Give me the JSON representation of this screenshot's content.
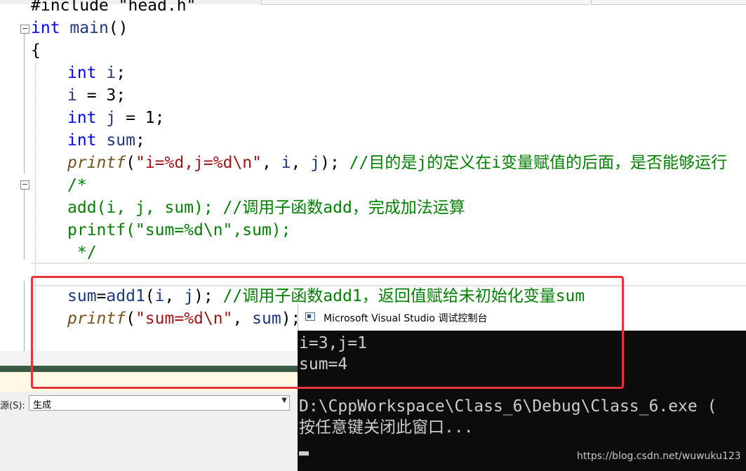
{
  "editor": {
    "lines": [
      {
        "parts": [
          {
            "c": "plain",
            "t": "#include \"head.h\""
          }
        ]
      },
      {
        "parts": [
          {
            "c": "kw",
            "t": "int"
          },
          {
            "c": "plain",
            "t": " "
          },
          {
            "c": "id",
            "t": "main"
          },
          {
            "c": "plain",
            "t": "()"
          }
        ]
      },
      {
        "parts": [
          {
            "c": "plain",
            "t": "{"
          }
        ]
      },
      {
        "parts": [
          {
            "c": "kw",
            "t": "int"
          },
          {
            "c": "plain",
            "t": " "
          },
          {
            "c": "id",
            "t": "i"
          },
          {
            "c": "plain",
            "t": ";"
          }
        ]
      },
      {
        "parts": [
          {
            "c": "id",
            "t": "i"
          },
          {
            "c": "plain",
            "t": " = 3;"
          }
        ]
      },
      {
        "parts": [
          {
            "c": "kw",
            "t": "int"
          },
          {
            "c": "plain",
            "t": " "
          },
          {
            "c": "id",
            "t": "j"
          },
          {
            "c": "plain",
            "t": " = 1;"
          }
        ]
      },
      {
        "parts": [
          {
            "c": "kw",
            "t": "int"
          },
          {
            "c": "plain",
            "t": " "
          },
          {
            "c": "id",
            "t": "sum"
          },
          {
            "c": "plain",
            "t": ";"
          }
        ]
      },
      {
        "parts": [
          {
            "c": "fn",
            "t": "printf"
          },
          {
            "c": "plain",
            "t": "("
          },
          {
            "c": "str",
            "t": "\"i=%d,j=%d"
          },
          {
            "c": "esc",
            "t": "\\n"
          },
          {
            "c": "str",
            "t": "\""
          },
          {
            "c": "plain",
            "t": ", "
          },
          {
            "c": "id",
            "t": "i"
          },
          {
            "c": "plain",
            "t": ", "
          },
          {
            "c": "id",
            "t": "j"
          },
          {
            "c": "plain",
            "t": "); "
          },
          {
            "c": "cmt",
            "t": "//目的是j的定义在i变量赋值的后面，是否能够运行"
          }
        ]
      },
      {
        "parts": [
          {
            "c": "cmt",
            "t": "/*"
          }
        ]
      },
      {
        "parts": [
          {
            "c": "cmt",
            "t": "add(i, j, sum); //调用子函数add，完成加法运算"
          }
        ]
      },
      {
        "parts": [
          {
            "c": "cmt",
            "t": "printf(\"sum=%d\\n\",sum);"
          }
        ]
      },
      {
        "parts": [
          {
            "c": "cmt",
            "t": " */"
          }
        ]
      },
      {
        "parts": [
          {
            "c": "plain",
            "t": ""
          }
        ]
      },
      {
        "parts": [
          {
            "c": "id",
            "t": "sum"
          },
          {
            "c": "plain",
            "t": "="
          },
          {
            "c": "id",
            "t": "add1"
          },
          {
            "c": "plain",
            "t": "("
          },
          {
            "c": "id",
            "t": "i"
          },
          {
            "c": "plain",
            "t": ", "
          },
          {
            "c": "id",
            "t": "j"
          },
          {
            "c": "plain",
            "t": "); "
          },
          {
            "c": "cmt",
            "t": "//调用子函数add1，返回值赋给未初始化变量sum"
          }
        ]
      },
      {
        "parts": [
          {
            "c": "fn",
            "t": "printf"
          },
          {
            "c": "plain",
            "t": "("
          },
          {
            "c": "str",
            "t": "\"sum=%d"
          },
          {
            "c": "esc",
            "t": "\\n"
          },
          {
            "c": "str",
            "t": "\""
          },
          {
            "c": "plain",
            "t": ", "
          },
          {
            "c": "id",
            "t": "sum"
          },
          {
            "c": "plain",
            "t": ");"
          }
        ]
      }
    ]
  },
  "output_panel": {
    "source_label": "源(S):",
    "source_value": "生成"
  },
  "console": {
    "title": "Microsoft Visual Studio 调试控制台",
    "lines": [
      "i=3,j=1",
      "sum=4",
      "",
      "D:\\CppWorkspace\\Class_6\\Debug\\Class_6.exe (",
      "按任意键关闭此窗口..."
    ]
  },
  "watermark": "https://blog.csdn.net/wuwuku123",
  "colors": {
    "keyword": "#0000ff",
    "comment": "#008000",
    "string": "#a31515",
    "highlight_box": "#e8323c"
  }
}
